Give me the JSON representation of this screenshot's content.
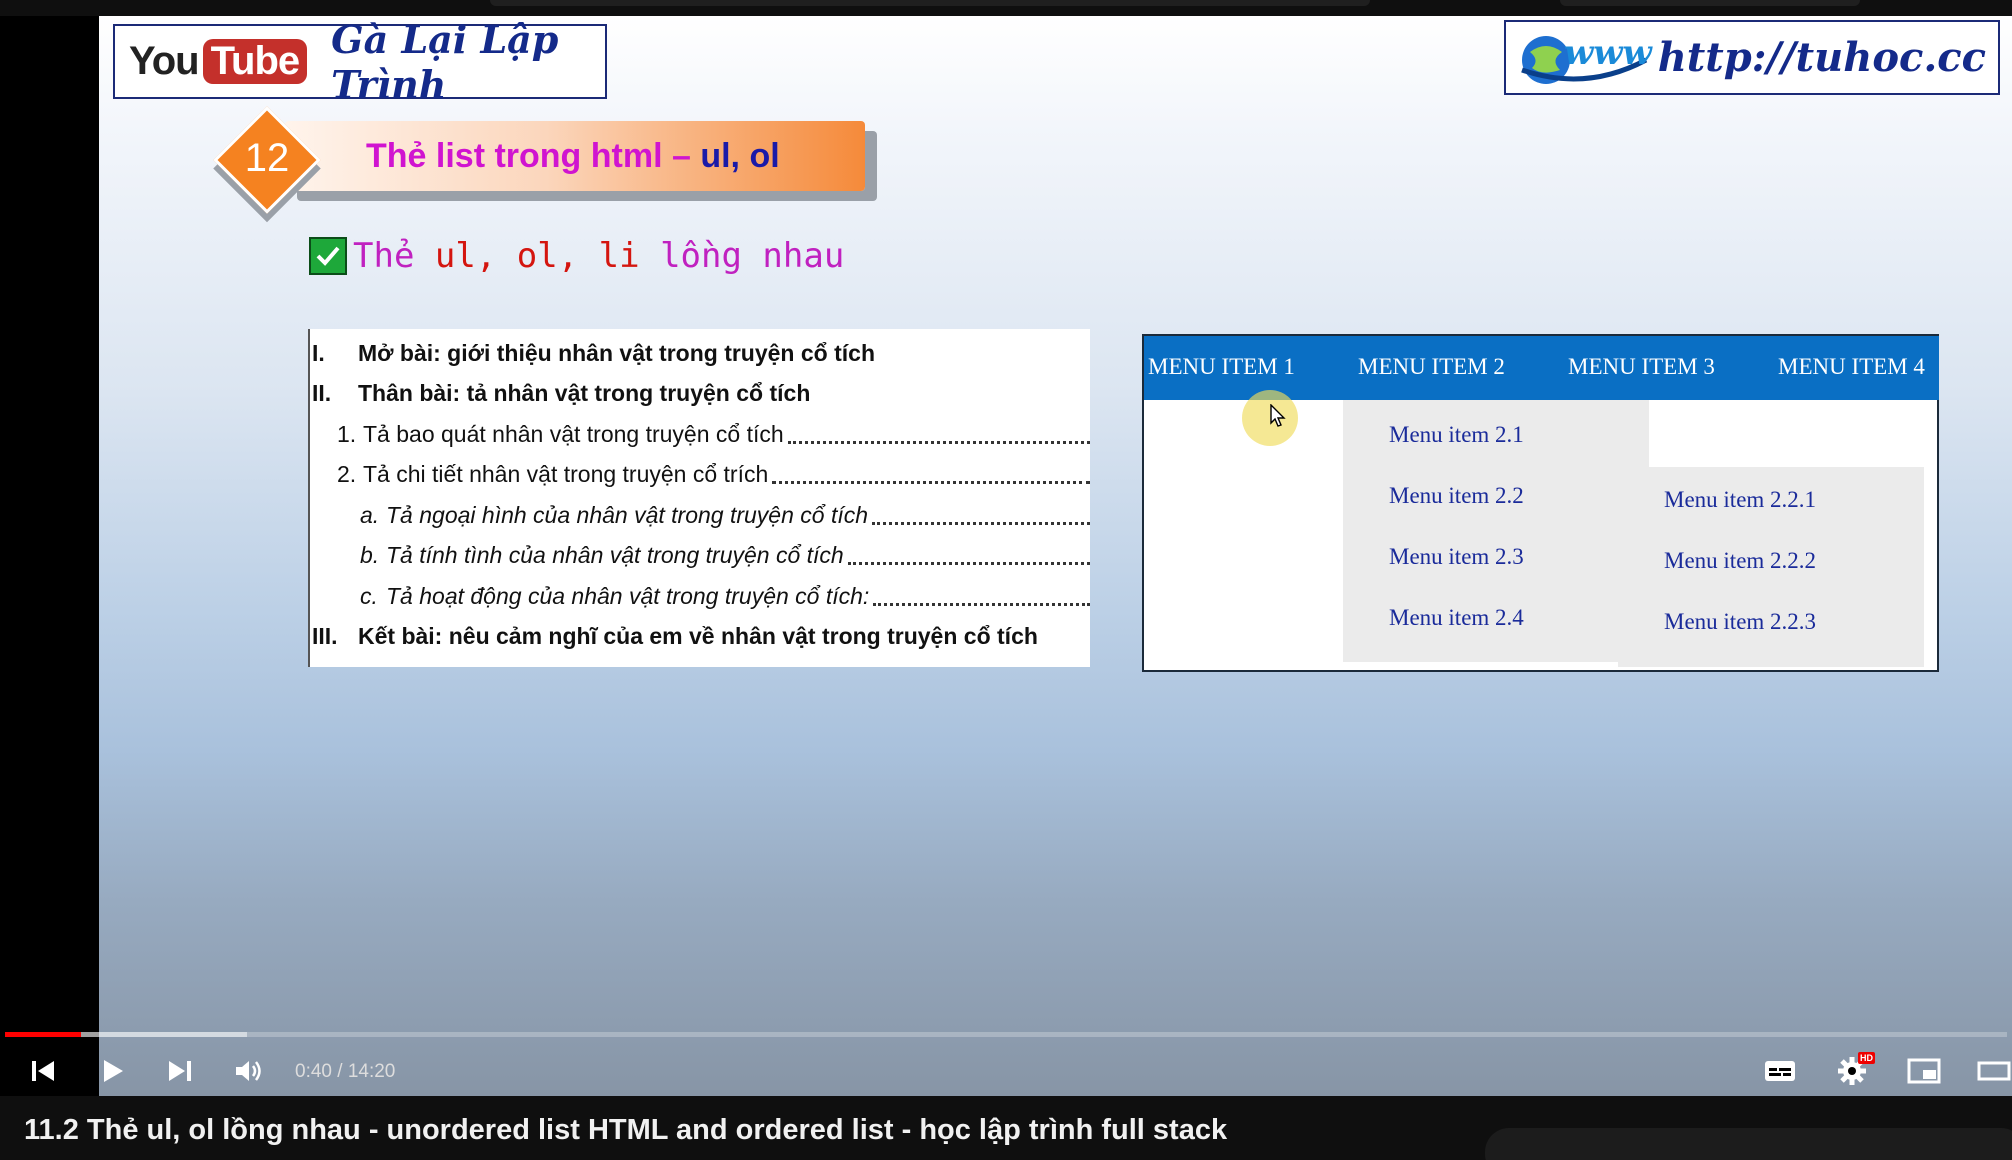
{
  "channel_banner": {
    "logo_you": "You",
    "logo_tube": "Tube",
    "channel_name": "Gà Lại Lập Trình"
  },
  "url_banner": {
    "globe_text": "www",
    "url": "http://tuhoc.cc"
  },
  "lesson": {
    "number": "12",
    "title_main": "Thẻ list trong html – ",
    "title_accent": "ul, ol"
  },
  "subtitle": {
    "prefix": "Thẻ ",
    "code": "ul, ol, li",
    "suffix": " lồng nhau"
  },
  "outline": {
    "rows": [
      {
        "num": "I.",
        "text": "Mở bài: giới thiệu nhân vật trong truyện cổ tích",
        "style": "bold",
        "dots": false
      },
      {
        "num": "II.",
        "text": "Thân bài: tả nhân vật trong truyện cổ tích",
        "style": "bold",
        "dots": false
      },
      {
        "num": "1.",
        "text": "Tả bao quát nhân vật trong truyện cổ tích",
        "style": "normal",
        "dots": true
      },
      {
        "num": "2.",
        "text": "Tả chi tiết nhân vật trong truyện cổ trích",
        "style": "normal",
        "dots": true
      },
      {
        "num": "a.",
        "text": "Tả ngoại hình của nhân vật trong truyện cổ tích",
        "style": "italic",
        "dots": true
      },
      {
        "num": "b.",
        "text": "Tả tính tình của nhân vật trong truyện cổ tích",
        "style": "italic",
        "dots": true
      },
      {
        "num": "c.",
        "text": "Tả hoạt động của nhân vật trong truyện cổ tích:",
        "style": "italic",
        "dots": true
      },
      {
        "num": "III.",
        "text": "Kết bài: nêu cảm nghĩ của em về nhân vật trong truyện cổ tích",
        "style": "bold",
        "dots": false
      }
    ]
  },
  "menu_demo": {
    "top_items": [
      "MENU ITEM 1",
      "MENU ITEM 2",
      "MENU ITEM 3",
      "MENU ITEM 4"
    ],
    "submenu_2": [
      "Menu item 2.1",
      "Menu item 2.2",
      "Menu item 2.3",
      "Menu item 2.4"
    ],
    "submenu_2_2": [
      "Menu item 2.2.1",
      "Menu item 2.2.2",
      "Menu item 2.2.3"
    ]
  },
  "player": {
    "time_display": "0:40 / 14:20",
    "progress_played_fraction": 0.038,
    "progress_buffered_fraction": 0.121,
    "hd_badge": "HD"
  },
  "video_title": "11.2 Thẻ ul, ol lồng nhau - unordered list HTML and ordered list - học lập trình full stack",
  "colors": {
    "accent_red": "#ff0000",
    "menu_blue": "#0a6fc4",
    "lesson_orange": "#f58220",
    "title_magenta": "#d014d0"
  }
}
